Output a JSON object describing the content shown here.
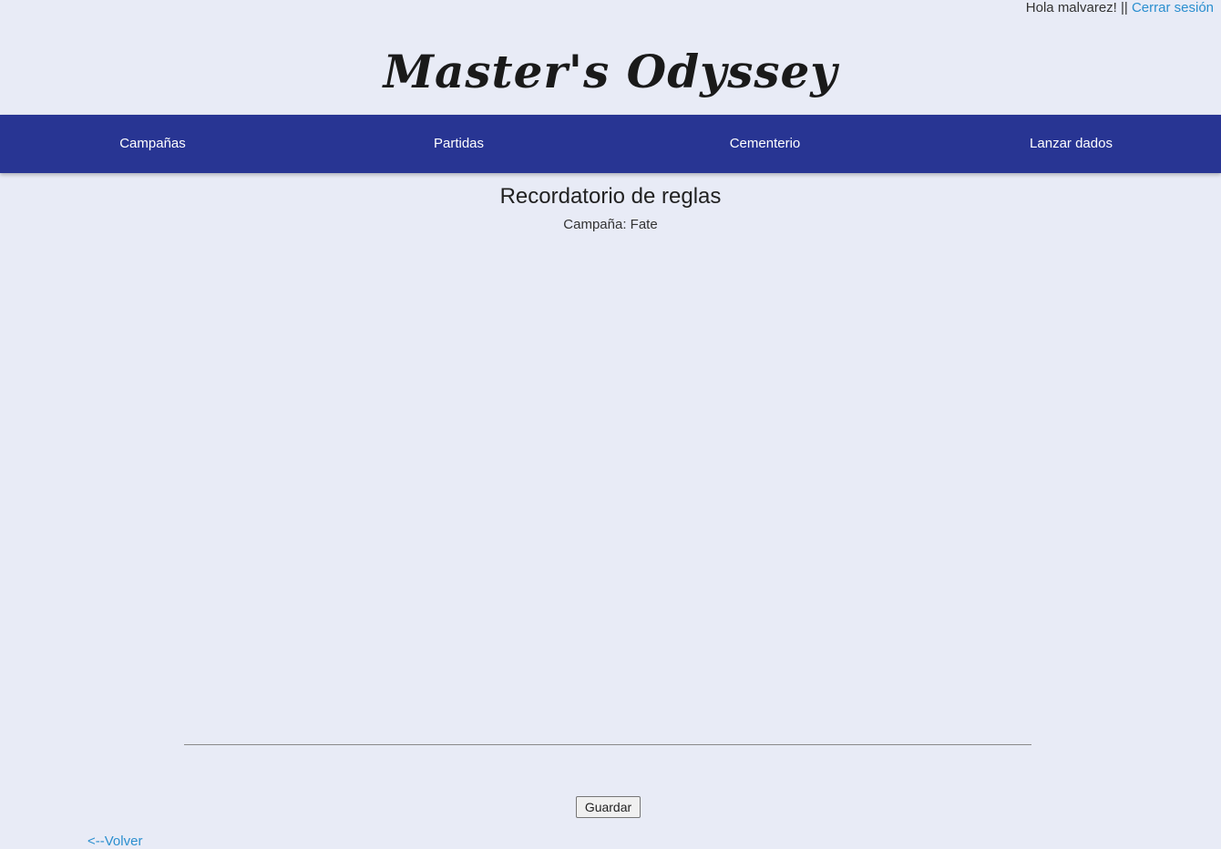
{
  "header": {
    "greeting": "Hola malvarez! || ",
    "logout_label": "Cerrar sesión",
    "site_title": "Master's Odyssey"
  },
  "nav": {
    "items": [
      {
        "label": "Campañas"
      },
      {
        "label": "Partidas"
      },
      {
        "label": "Cementerio"
      },
      {
        "label": "Lanzar dados"
      }
    ]
  },
  "main": {
    "title": "Recordatorio de reglas",
    "campaign_label": "Campaña: Fate",
    "rules_value": "",
    "save_label": "Guardar",
    "back_label": "<--Volver"
  },
  "colors": {
    "background": "#e8ebf6",
    "navbar": "#283593",
    "link": "#2b8fcf"
  }
}
